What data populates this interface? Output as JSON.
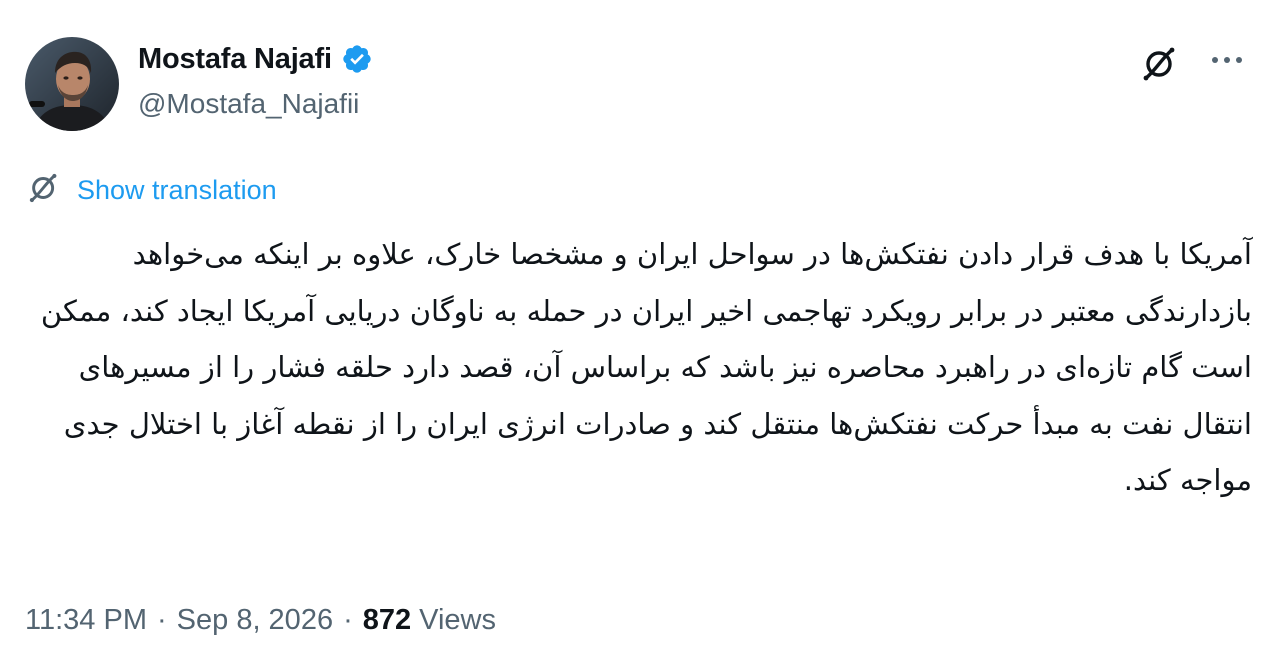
{
  "author": {
    "display_name": "Mostafa Najafi",
    "handle": "@Mostafa_Najafii",
    "verified": true,
    "avatar": "profile-photo"
  },
  "actions": {
    "translate_icon": "translate-icon",
    "more_icon": "more-icon"
  },
  "translation": {
    "label": "Show translation",
    "icon": "translate-icon"
  },
  "tweet": {
    "text": "آمریکا با هدف قرار دادن نفتکش‌ها در سواحل ایران و مشخصا خارک، علاوه بر اینکه می‌خواهد بازدارندگی معتبر در برابر رویکرد تهاجمی اخیر ایران در حمله به ناوگان دریایی آمریکا ایجاد کند، ممکن است گام تازه‌ای در راهبرد محاصره نیز باشد که براساس آن، قصد دارد حلقه فشار را از مسیرهای انتقال نفت به مبدأ حرکت نفتکش‌ها منتقل کند و صادرات انرژی ایران را از نقطه آغاز با اختلال جدی مواجه کند."
  },
  "meta": {
    "time": "11:34 PM",
    "separator": "·",
    "date": "Sep 8, 2026",
    "views_count": "872",
    "views_label": "Views"
  },
  "colors": {
    "accent": "#1d9bf0",
    "text_primary": "#0f1419",
    "text_secondary": "#536471"
  }
}
